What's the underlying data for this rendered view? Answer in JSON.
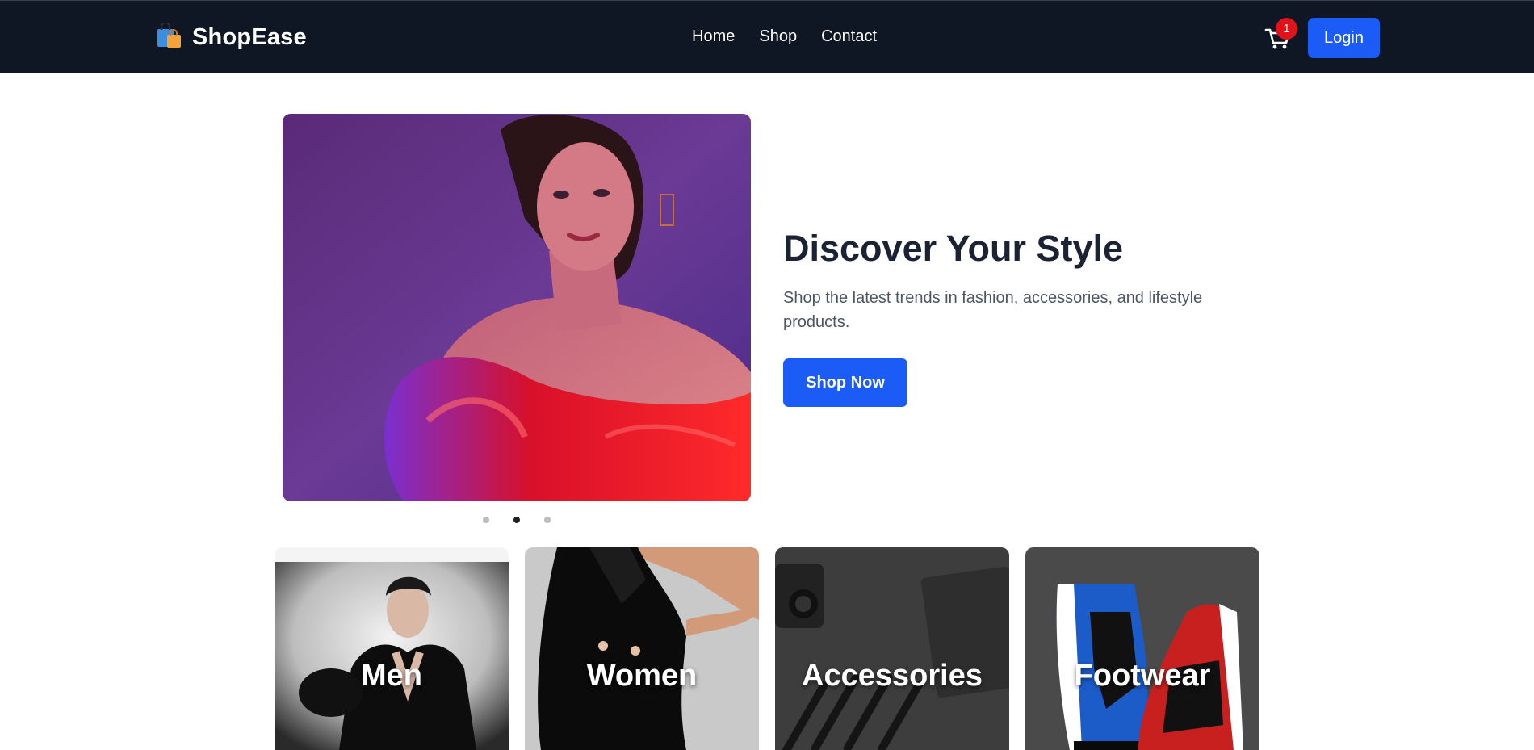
{
  "brand": {
    "name": "ShopEase",
    "icon": "shopping-bags-icon"
  },
  "nav": {
    "links": [
      "Home",
      "Shop",
      "Contact"
    ]
  },
  "cart": {
    "icon": "cart-icon",
    "count": "1"
  },
  "login": {
    "label": "Login"
  },
  "hero": {
    "title": "Discover Your Style",
    "subtitle": "Shop the latest trends in fashion, accessories, and lifestyle products.",
    "cta": "Shop Now",
    "slides": 3,
    "active_slide": 2
  },
  "categories": [
    {
      "label": "Men"
    },
    {
      "label": "Women"
    },
    {
      "label": "Accessories"
    },
    {
      "label": "Footwear"
    }
  ],
  "colors": {
    "navbar": "#0f1624",
    "primary": "#1a5cf5",
    "badge": "#e0121a",
    "title": "#1a2233"
  }
}
